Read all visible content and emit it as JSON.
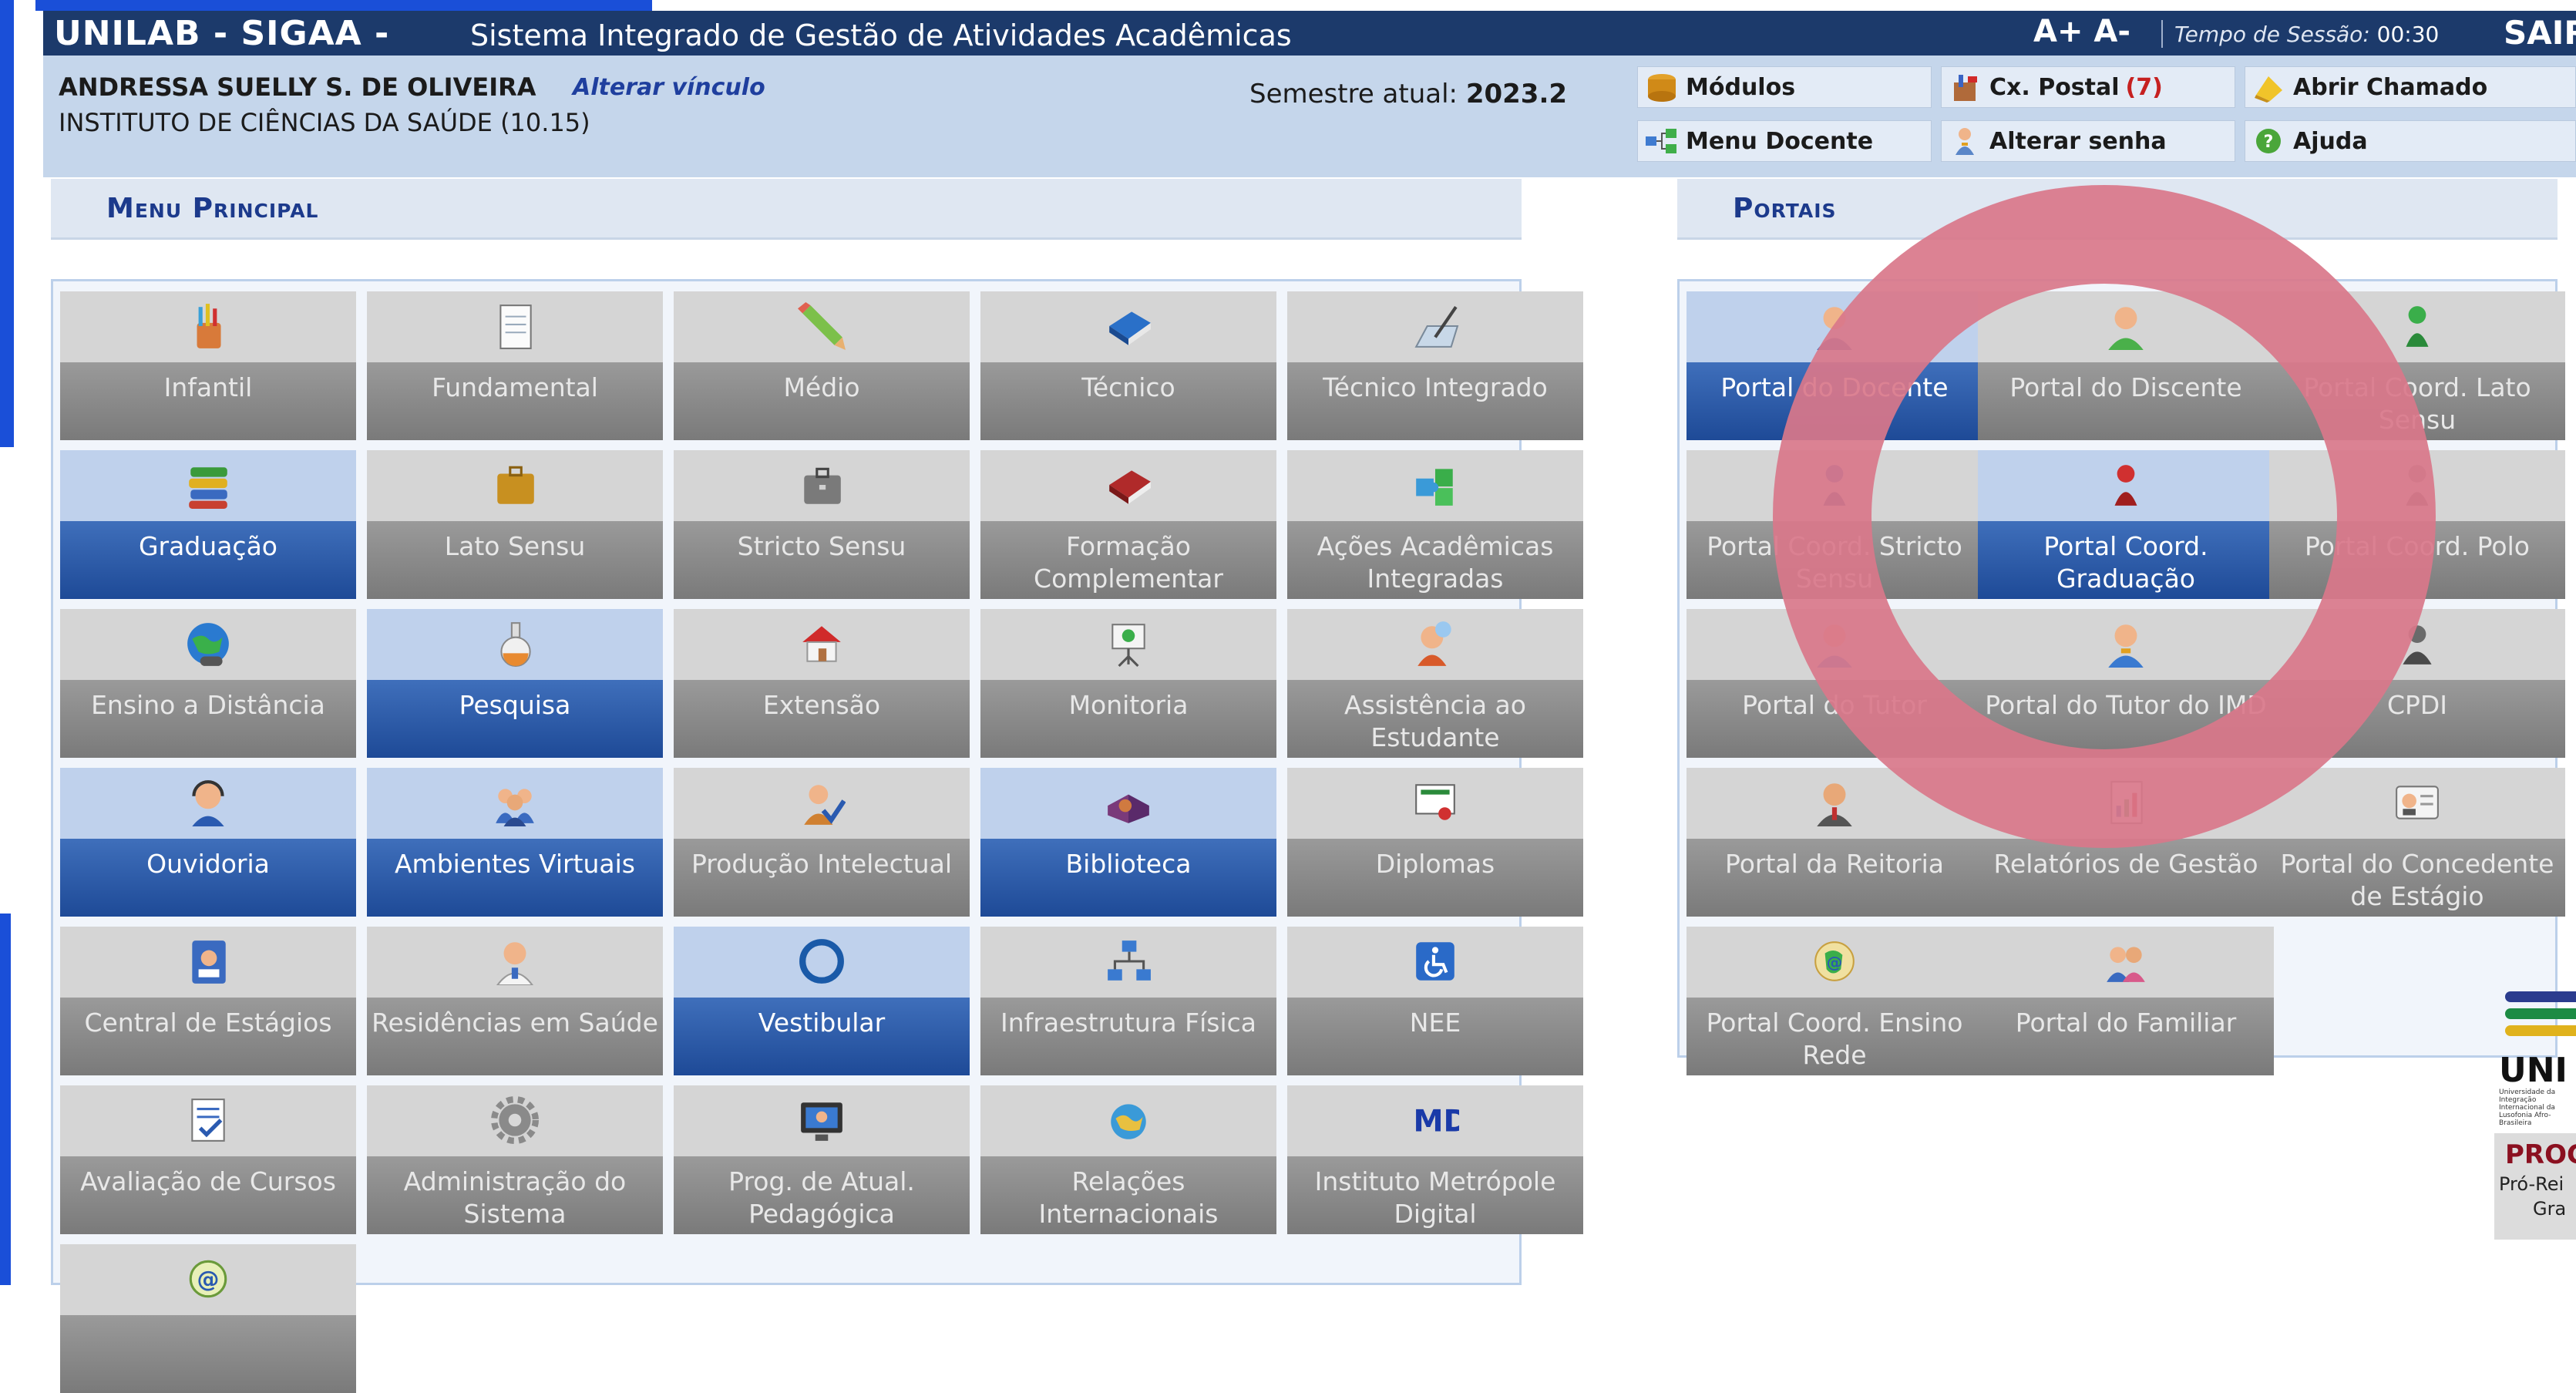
{
  "header": {
    "brand": "UNILAB - SIGAA -",
    "system_name": "Sistema Integrado de Gestão de Atividades Acadêmicas",
    "font_controls": "A+ A-",
    "session_label": "Tempo de Sessão:",
    "session_time": "00:30",
    "logout": "SAIR"
  },
  "user": {
    "name": "ANDRESSA SUELLY S. DE OLIVEIRA",
    "change_link": "Alterar vínculo",
    "unit": "INSTITUTO DE CIÊNCIAS DA SAÚDE (10.15)",
    "semester_label": "Semestre atual:",
    "semester_value": "2023.2"
  },
  "quick_links": {
    "modules": "Módulos",
    "mailbox": "Cx. Postal",
    "mailbox_count": "(7)",
    "open_ticket": "Abrir Chamado",
    "teacher_menu": "Menu Docente",
    "change_password": "Alterar senha",
    "help": "Ajuda"
  },
  "menu": {
    "title": "Menu Principal",
    "tiles": [
      {
        "label": "Infantil",
        "icon": "pencil-cup-icon"
      },
      {
        "label": "Fundamental",
        "icon": "notepad-icon"
      },
      {
        "label": "Médio",
        "icon": "pencil-icon"
      },
      {
        "label": "Técnico",
        "icon": "blue-book-icon"
      },
      {
        "label": "Técnico Integrado",
        "icon": "drawing-board-icon"
      },
      {
        "label": "Graduação",
        "icon": "books-stack-icon"
      },
      {
        "label": "Lato Sensu",
        "icon": "briefcase-icon"
      },
      {
        "label": "Stricto Sensu",
        "icon": "briefcase-gray-icon"
      },
      {
        "label": "Formação Complementar",
        "icon": "red-book-icon"
      },
      {
        "label": "Ações Acadêmicas Integradas",
        "icon": "puzzle-icon"
      },
      {
        "label": "Ensino a Distância",
        "icon": "globe-icon"
      },
      {
        "label": "Pesquisa",
        "icon": "flask-icon"
      },
      {
        "label": "Extensão",
        "icon": "house-icon"
      },
      {
        "label": "Monitoria",
        "icon": "presentation-board-icon"
      },
      {
        "label": "Assistência ao Estudante",
        "icon": "support-person-icon"
      },
      {
        "label": "Ouvidoria",
        "icon": "headset-icon"
      },
      {
        "label": "Ambientes Virtuais",
        "icon": "group-icon"
      },
      {
        "label": "Produção Intelectual",
        "icon": "person-check-icon"
      },
      {
        "label": "Biblioteca",
        "icon": "open-book-icon"
      },
      {
        "label": "Diplomas",
        "icon": "certificate-icon"
      },
      {
        "label": "Central de Estágios",
        "icon": "id-card-icon"
      },
      {
        "label": "Residências em Saúde",
        "icon": "doctor-icon"
      },
      {
        "label": "Vestibular",
        "icon": "vestibular-logo-icon"
      },
      {
        "label": "Infraestrutura Física",
        "icon": "network-icon"
      },
      {
        "label": "NEE",
        "icon": "accessibility-icon"
      },
      {
        "label": "Avaliação de Cursos",
        "icon": "checklist-icon"
      },
      {
        "label": "Administração do Sistema",
        "icon": "gear-icon"
      },
      {
        "label": "Prog. de Atual. Pedagógica",
        "icon": "monitor-icon"
      },
      {
        "label": "Relações Internacionais",
        "icon": "globe-mail-icon"
      },
      {
        "label": "Instituto Metrópole Digital",
        "icon": "imd-logo-icon"
      },
      {
        "label": "",
        "icon": "email-globe-icon"
      }
    ]
  },
  "portals": {
    "title": "Portais",
    "tiles": [
      {
        "label": "Portal do Docente",
        "icon": "teacher-icon"
      },
      {
        "label": "Portal do Discente",
        "icon": "student-icon"
      },
      {
        "label": "Portal Coord. Lato Sensu",
        "icon": "green-pawn-icon"
      },
      {
        "label": "Portal Coord. Stricto Sensu",
        "icon": "pawn-icon"
      },
      {
        "label": "Portal Coord. Graduação",
        "icon": "red-pawn-icon"
      },
      {
        "label": "Portal Coord. Polo",
        "icon": "pawn-gray-icon"
      },
      {
        "label": "Portal do Tutor",
        "icon": "tutor-icon"
      },
      {
        "label": "Portal do Tutor do IMD",
        "icon": "tutor-imd-icon"
      },
      {
        "label": "CPDI",
        "icon": "cpdi-icon"
      },
      {
        "label": "Portal da Reitoria",
        "icon": "dean-icon"
      },
      {
        "label": "Relatórios de Gestão",
        "icon": "report-icon"
      },
      {
        "label": "Portal do Concedente de Estágio",
        "icon": "concedente-icon"
      },
      {
        "label": "Portal Coord. Ensino Rede",
        "icon": "brazil-globe-icon"
      },
      {
        "label": "Portal do Familiar",
        "icon": "family-icon"
      }
    ]
  },
  "logo": {
    "name": "UNI",
    "subtitle": "Universidade da Integração Internacional da Lusofonia Afro-Brasileira"
  },
  "prograd": {
    "title": "PROG",
    "line1": "Pró-Rei",
    "line2": "Gra"
  }
}
